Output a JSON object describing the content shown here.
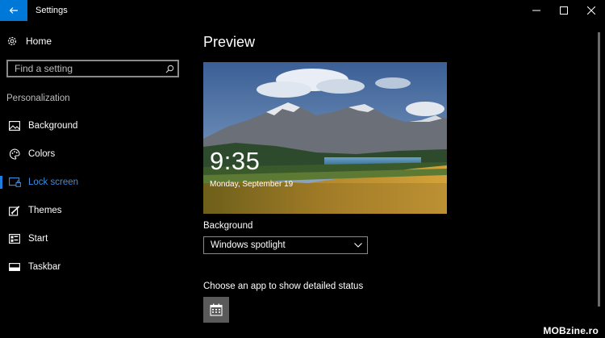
{
  "window": {
    "title": "Settings",
    "controls": [
      "minimize-icon",
      "maximize-icon",
      "close-icon"
    ]
  },
  "sidebar": {
    "home_label": "Home",
    "search_placeholder": "Find a setting",
    "section_label": "Personalization",
    "items": [
      {
        "label": "Background",
        "icon": "image-icon",
        "active": false
      },
      {
        "label": "Colors",
        "icon": "palette-icon",
        "active": false
      },
      {
        "label": "Lock screen",
        "icon": "lock-screen-icon",
        "active": true
      },
      {
        "label": "Themes",
        "icon": "brush-icon",
        "active": false
      },
      {
        "label": "Start",
        "icon": "start-icon",
        "active": false
      },
      {
        "label": "Taskbar",
        "icon": "taskbar-icon",
        "active": false
      }
    ]
  },
  "main": {
    "preview_title": "Preview",
    "lock_time": "9:35",
    "lock_date": "Monday, September 19",
    "background_label": "Background",
    "background_value": "Windows spotlight",
    "status_label": "Choose an app to show detailed status",
    "status_app_icon": "calendar-icon"
  },
  "watermark": "MOBzine.ro",
  "colors": {
    "accent": "#0078d7",
    "active_text": "#3c8fe0"
  }
}
